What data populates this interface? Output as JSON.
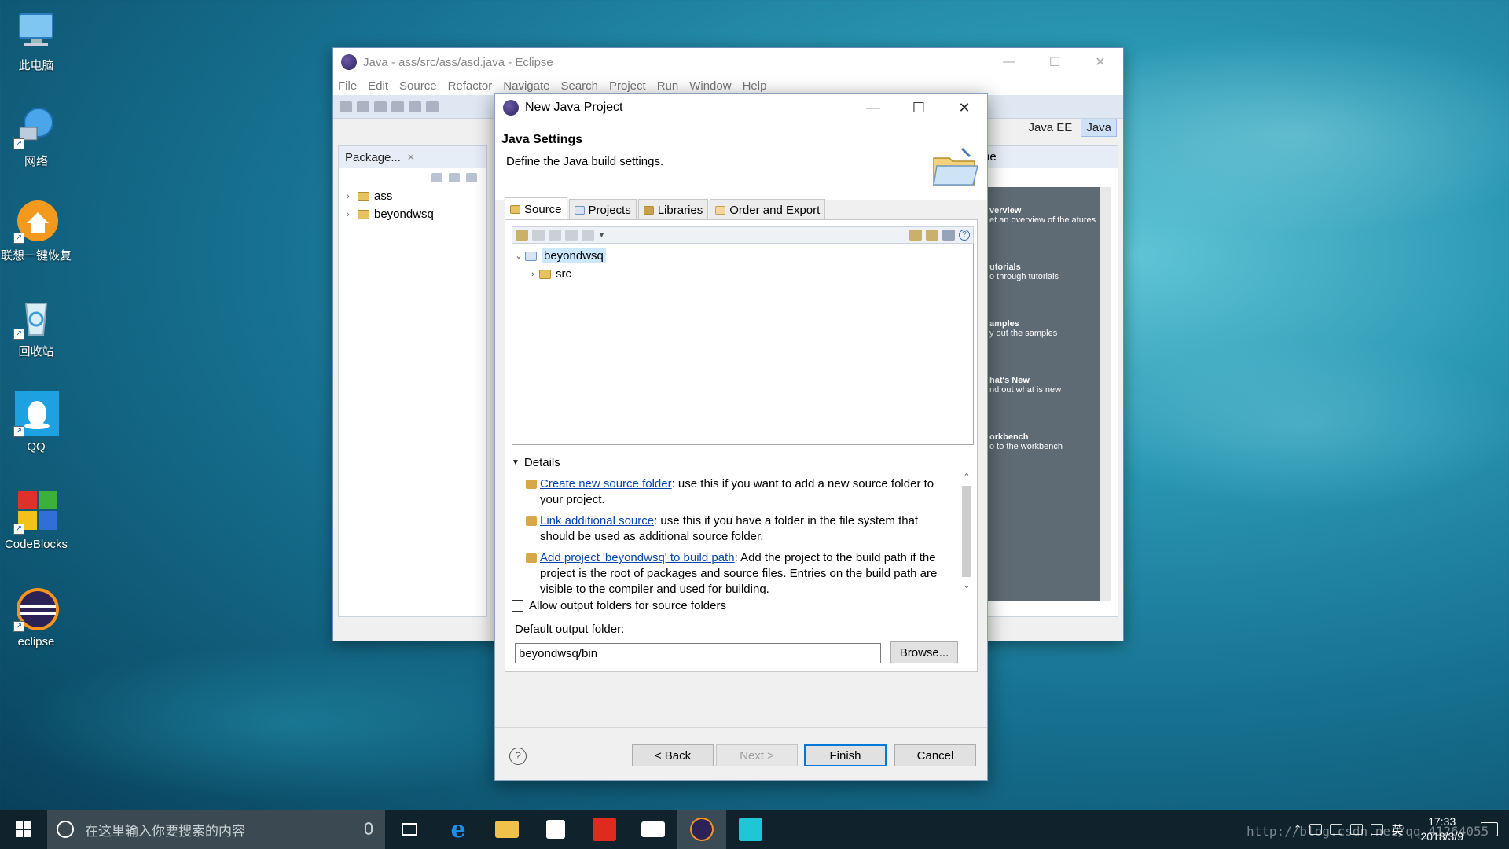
{
  "desktop": {
    "icons": [
      {
        "label": "此电脑"
      },
      {
        "label": "网络"
      },
      {
        "label": "联想一键恢复"
      },
      {
        "label": "回收站"
      },
      {
        "label": "QQ"
      },
      {
        "label": "CodeBlocks"
      },
      {
        "label": "eclipse"
      }
    ]
  },
  "eclipse": {
    "title": "Java - ass/src/ass/asd.java - Eclipse",
    "menu": [
      "File",
      "Edit",
      "Source",
      "Refactor",
      "Navigate",
      "Search",
      "Project",
      "Run",
      "Window",
      "Help"
    ],
    "perspectives": [
      "Java EE",
      "Java"
    ],
    "package_explorer": {
      "title": "Package...",
      "projects": [
        "ass",
        "beyondwsq"
      ]
    },
    "welcome": {
      "tab": "ne",
      "items": [
        {
          "title": "verview",
          "desc": "et an overview of the atures"
        },
        {
          "title": "utorials",
          "desc": "o through tutorials"
        },
        {
          "title": "amples",
          "desc": "y out the samples"
        },
        {
          "title": "hat's New",
          "desc": "nd out what is new"
        },
        {
          "title": "orkbench",
          "desc": "o to the workbench"
        }
      ]
    }
  },
  "dialog": {
    "title": "New Java Project",
    "header_title": "Java Settings",
    "header_desc": "Define the Java build settings.",
    "tabs": [
      "Source",
      "Projects",
      "Libraries",
      "Order and Export"
    ],
    "source_tree": {
      "project": "beyondwsq",
      "folder": "src"
    },
    "details_label": "Details",
    "details": [
      {
        "link": "Create new source folder",
        "text": ": use this if you want to add a new source folder to your project."
      },
      {
        "link": "Link additional source",
        "text": ": use this if you have a folder in the file system that should be used as additional source folder."
      },
      {
        "link": "Add project 'beyondwsq' to build path",
        "text": ": Add the project to the build path if the project is the root of packages and source files. Entries on the build path are visible to the compiler and used for building."
      }
    ],
    "allow_output_label": "Allow output folders for source folders",
    "output_folder_label": "Default output folder:",
    "output_folder_value": "beyondwsq/bin",
    "browse_label": "Browse...",
    "back_label": "< Back",
    "next_label": "Next >",
    "finish_label": "Finish",
    "cancel_label": "Cancel"
  },
  "taskbar": {
    "search_placeholder": "在这里输入你要搜索的内容",
    "ime": "英",
    "time": "17:33",
    "date": "2018/3/9"
  },
  "watermark": "http://blog.csdn.net/qq_41264055"
}
